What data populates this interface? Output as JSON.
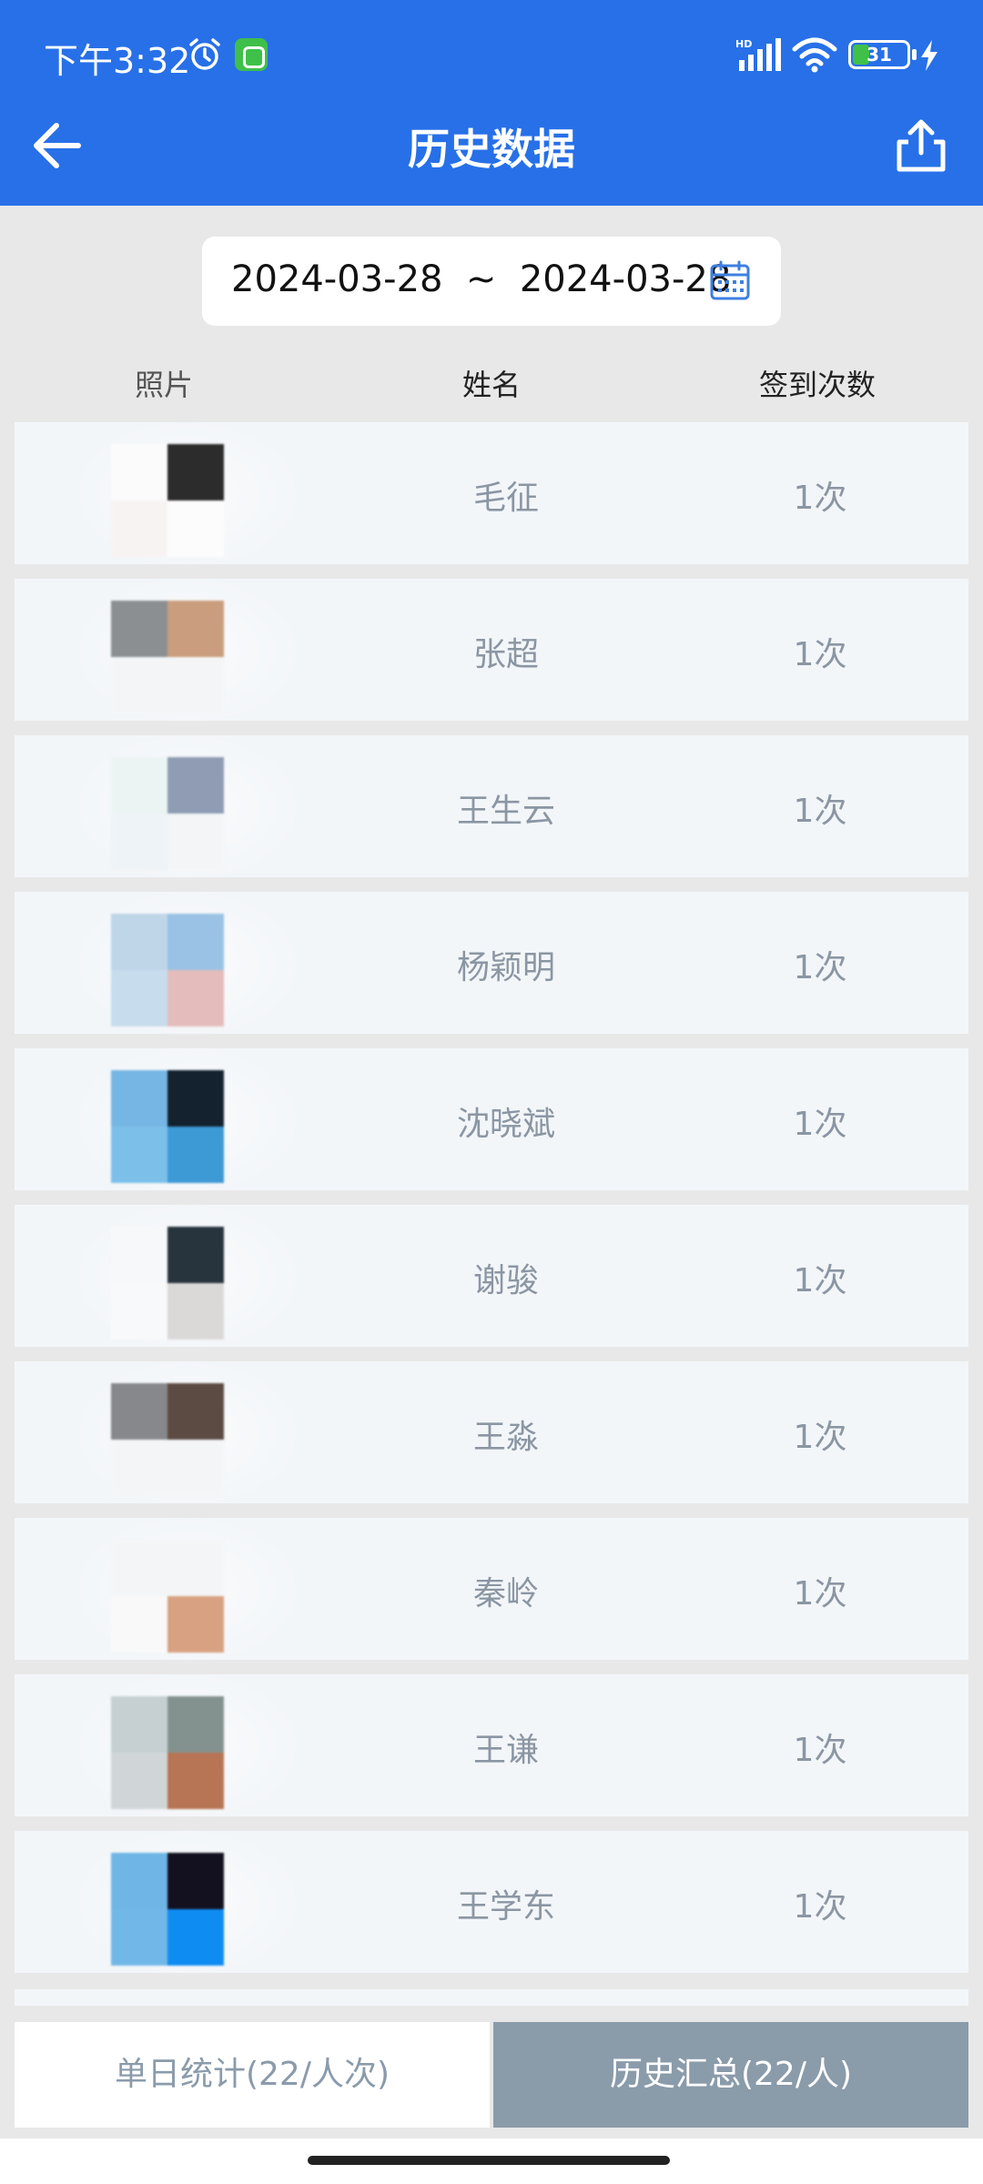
{
  "status_bar": {
    "time": "下午3:32",
    "battery": "31",
    "battery_level_pct": 31,
    "network": "HD"
  },
  "header": {
    "title": "历史数据",
    "back_icon": "arrow-left-icon",
    "share_icon": "share-icon"
  },
  "date_range": {
    "text": "2024-03-28  ~  2024-03-28",
    "icon": "calendar-icon"
  },
  "table": {
    "columns": [
      "照片",
      "姓名",
      "签到次数"
    ],
    "rows": [
      {
        "name": "毛征",
        "count": "1次",
        "avatar_colors": [
          "#fbfbfb",
          "#2c2c2c",
          "#f7f3f3",
          "#fdfcfc"
        ]
      },
      {
        "name": "张超",
        "count": "1次",
        "avatar_colors": [
          "#8b8f92",
          "#c99d7d",
          "#f3f5f7",
          "#f3f5f7"
        ]
      },
      {
        "name": "王生云",
        "count": "1次",
        "avatar_colors": [
          "#ecf4f3",
          "#8f9cb4",
          "#eef3f7",
          "#f3f5f7"
        ]
      },
      {
        "name": "杨颖明",
        "count": "1次",
        "avatar_colors": [
          "#bfd6e8",
          "#99c2e4",
          "#c7dcec",
          "#e5bcbc"
        ]
      },
      {
        "name": "沈晓斌",
        "count": "1次",
        "avatar_colors": [
          "#76b6e4",
          "#142230",
          "#7cc0ea",
          "#3d9ad4"
        ]
      },
      {
        "name": "谢骏",
        "count": "1次",
        "avatar_colors": [
          "#f7f8f9",
          "#27343e",
          "#f8f9fa",
          "#dbd8d8"
        ]
      },
      {
        "name": "王淼",
        "count": "1次",
        "avatar_colors": [
          "#87888c",
          "#5c4b42",
          "#f3f5f7",
          "#f3f5f7"
        ]
      },
      {
        "name": "秦岭",
        "count": "1次",
        "avatar_colors": [
          "#f3f5f7",
          "#f3f5f7",
          "#f8f9f8",
          "#d8a282"
        ]
      },
      {
        "name": "王谦",
        "count": "1次",
        "avatar_colors": [
          "#c6d0d2",
          "#84928f",
          "#d0d6d8",
          "#b77555"
        ]
      },
      {
        "name": "王学东",
        "count": "1次",
        "avatar_colors": [
          "#6fb6e6",
          "#13111f",
          "#71b7e8",
          "#0f8cf2"
        ]
      }
    ]
  },
  "tabs": {
    "daily": "单日统计(22/人次)",
    "history": "历史汇总(22/人)"
  }
}
